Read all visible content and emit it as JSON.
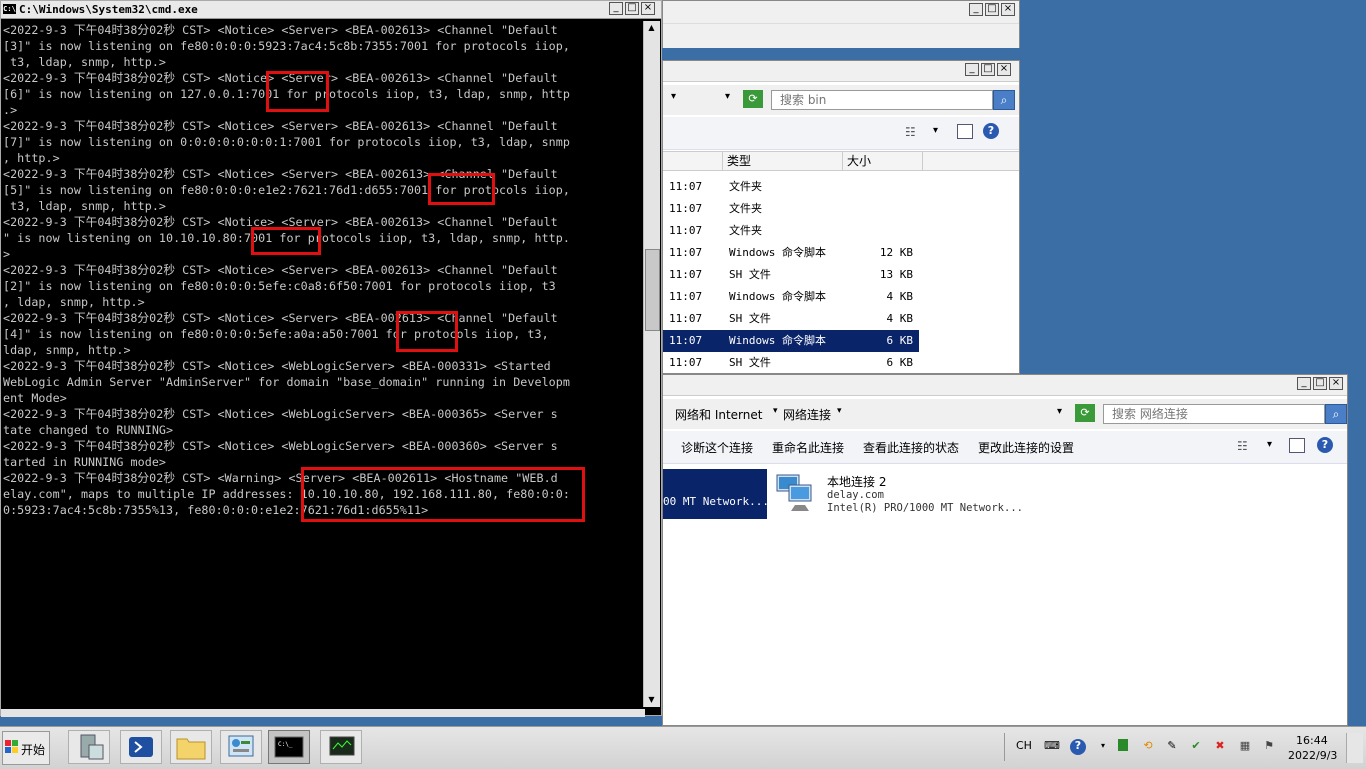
{
  "cmd": {
    "title": "C:\\Windows\\System32\\cmd.exe",
    "lines": [
      "<2022-9-3 下午04时38分02秒 CST> <Notice> <Server> <BEA-002613> <Channel \"Default",
      "[3]\" is now listening on fe80:0:0:0:5923:7ac4:5c8b:7355:7001 for protocols iiop,",
      " t3, ldap, snmp, http.>",
      "<2022-9-3 下午04时38分02秒 CST> <Notice> <Server> <BEA-002613> <Channel \"Default",
      "[6]\" is now listening on 127.0.0.1:7001 for protocols iiop, t3, ldap, snmp, http",
      ".>",
      "<2022-9-3 下午04时38分02秒 CST> <Notice> <Server> <BEA-002613> <Channel \"Default",
      "[7]\" is now listening on 0:0:0:0:0:0:0:1:7001 for protocols iiop, t3, ldap, snmp",
      ", http.>",
      "<2022-9-3 下午04时38分02秒 CST> <Notice> <Server> <BEA-002613> <Channel \"Default",
      "[5]\" is now listening on fe80:0:0:0:e1e2:7621:76d1:d655:7001 for protocols iiop,",
      " t3, ldap, snmp, http.>",
      "<2022-9-3 下午04时38分02秒 CST> <Notice> <Server> <BEA-002613> <Channel \"Default",
      "\" is now listening on 10.10.10.80:7001 for protocols iiop, t3, ldap, snmp, http.",
      ">",
      "<2022-9-3 下午04时38分02秒 CST> <Notice> <Server> <BEA-002613> <Channel \"Default",
      "[2]\" is now listening on fe80:0:0:0:5efe:c0a8:6f50:7001 for protocols iiop, t3",
      ", ldap, snmp, http.>",
      "<2022-9-3 下午04时38分02秒 CST> <Notice> <Server> <BEA-002613> <Channel \"Default",
      "[4]\" is now listening on fe80:0:0:0:5efe:a0a:a50:7001 for protocols iiop, t3,",
      "ldap, snmp, http.>",
      "<2022-9-3 下午04时38分02秒 CST> <Notice> <WebLogicServer> <BEA-000331> <Started",
      "WebLogic Admin Server \"AdminServer\" for domain \"base_domain\" running in Developm",
      "ent Mode>",
      "<2022-9-3 下午04时38分02秒 CST> <Notice> <WebLogicServer> <BEA-000365> <Server s",
      "tate changed to RUNNING>",
      "<2022-9-3 下午04时38分02秒 CST> <Notice> <WebLogicServer> <BEA-000360> <Server s",
      "tarted in RUNNING mode>",
      "<2022-9-3 下午04时38分02秒 CST> <Warning> <Server> <BEA-002611> <Hostname \"WEB.d",
      "elay.com\", maps to multiple IP addresses: 10.10.10.80, 192.168.111.80, fe80:0:0:",
      "0:5923:7ac4:5c8b:7355%13, fe80:0:0:0:e1e2:7621:76d1:d655%11>"
    ]
  },
  "bin_window": {
    "search_placeholder": "搜索 bin",
    "columns": {
      "type": "类型",
      "size": "大小"
    },
    "rows": [
      {
        "time": "11:07",
        "type": "文件夹",
        "size": ""
      },
      {
        "time": "11:07",
        "type": "文件夹",
        "size": ""
      },
      {
        "time": "11:07",
        "type": "文件夹",
        "size": ""
      },
      {
        "time": "11:07",
        "type": "Windows 命令脚本",
        "size": "12 KB"
      },
      {
        "time": "11:07",
        "type": "SH 文件",
        "size": "13 KB"
      },
      {
        "time": "11:07",
        "type": "Windows 命令脚本",
        "size": "4 KB"
      },
      {
        "time": "11:07",
        "type": "SH 文件",
        "size": "4 KB"
      },
      {
        "time": "11:07",
        "type": "Windows 命令脚本",
        "size": "6 KB"
      },
      {
        "time": "11:07",
        "type": "SH 文件",
        "size": "6 KB"
      }
    ],
    "selected_row": 7
  },
  "net_window": {
    "breadcrumb": [
      "网络和 Internet",
      "网络连接"
    ],
    "search_placeholder": "搜索 网络连接",
    "commands": [
      "诊断这个连接",
      "重命名此连接",
      "查看此连接的状态",
      "更改此连接的设置"
    ],
    "adapter1_partial": "00 MT Network...",
    "adapter2": {
      "name": "本地连接 2",
      "domain": "delay.com",
      "device": "Intel(R) PRO/1000 MT Network..."
    }
  },
  "taskbar": {
    "start_label": "开始",
    "lang": "CH",
    "time": "16:44",
    "date": "2022/9/3"
  },
  "colors": {
    "desktop": "#3a6ea5",
    "selection": "#0a246a",
    "highlight": "#e01010"
  }
}
